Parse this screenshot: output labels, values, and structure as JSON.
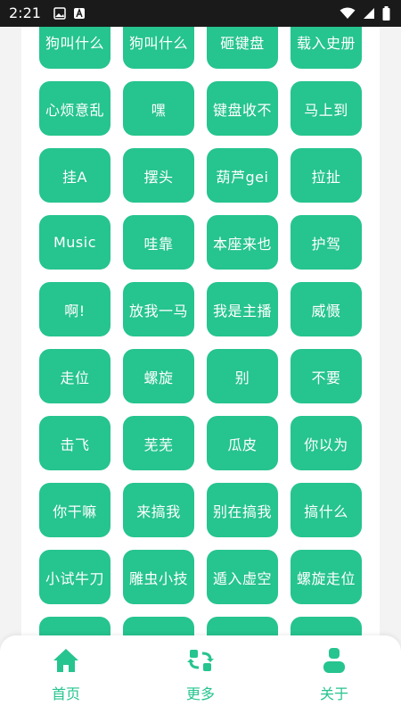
{
  "status": {
    "time": "2:21"
  },
  "sounds": [
    "狗叫什么",
    "狗叫什么",
    "砸键盘",
    "载入史册",
    "心烦意乱",
    "嘿",
    "键盘收不",
    "马上到",
    "挂A",
    "摆头",
    "葫芦gei",
    "拉扯",
    "Music",
    "哇靠",
    "本座来也",
    "护驾",
    "啊!",
    "放我一马",
    "我是主播",
    "威慑",
    "走位",
    "螺旋",
    "别",
    "不要",
    "击飞",
    "芜芜",
    "瓜皮",
    "你以为",
    "你干嘛",
    "来搞我",
    "别在搞我",
    "搞什么",
    "小试牛刀",
    "雕虫小技",
    "遁入虚空",
    "螺旋走位",
    "",
    "",
    "",
    ""
  ],
  "nav": {
    "home": "首页",
    "more": "更多",
    "about": "关于"
  },
  "colors": {
    "accent": "#26c48e",
    "status_bar": "#1a1a1a"
  }
}
